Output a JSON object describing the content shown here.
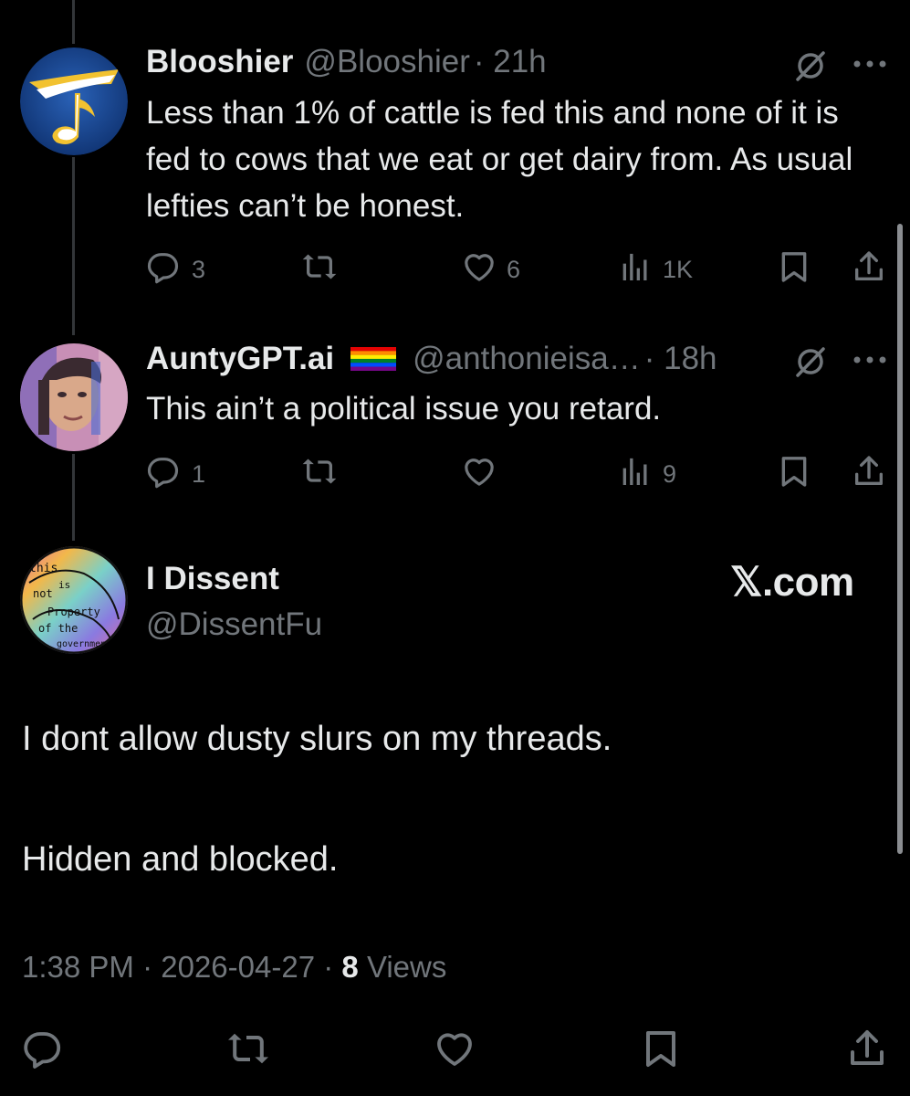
{
  "reply1": {
    "name": "Blooshier",
    "handle": "@Blooshier",
    "time": "· 21h",
    "text": "Less than 1% of cattle is fed this and none of it is fed to cows that we eat or get dairy from.  As usual lefties can’t be honest.",
    "replies": "3",
    "likes": "6",
    "views": "1K"
  },
  "reply2": {
    "name": "AuntyGPT.ai",
    "handle": "@anthonieisa…",
    "time": "· 18h",
    "text": "This ain’t a political issue you retard.",
    "replies": "1",
    "views": "9"
  },
  "main": {
    "name": "I Dissent",
    "handle": "@DissentFu",
    "brand": "𝕏.com",
    "avatar_text": [
      "this",
      "is",
      "not",
      "Property",
      "of the",
      "government"
    ],
    "paragraphs": [
      "I dont allow dusty slurs on my threads.",
      "Hidden and blocked."
    ],
    "time": "1:38 PM",
    "date": "2026-04-27",
    "views_count": "8",
    "views_label": "Views"
  },
  "icons": {
    "more": "more-icon",
    "grok": "grok-icon",
    "reply": "reply-icon",
    "repost": "repost-icon",
    "like": "like-icon",
    "views": "views-icon",
    "bookmark": "bookmark-icon",
    "share": "share-icon"
  },
  "colors": {
    "background": "#000000",
    "text": "#e7e9ea",
    "muted": "#71767b"
  }
}
